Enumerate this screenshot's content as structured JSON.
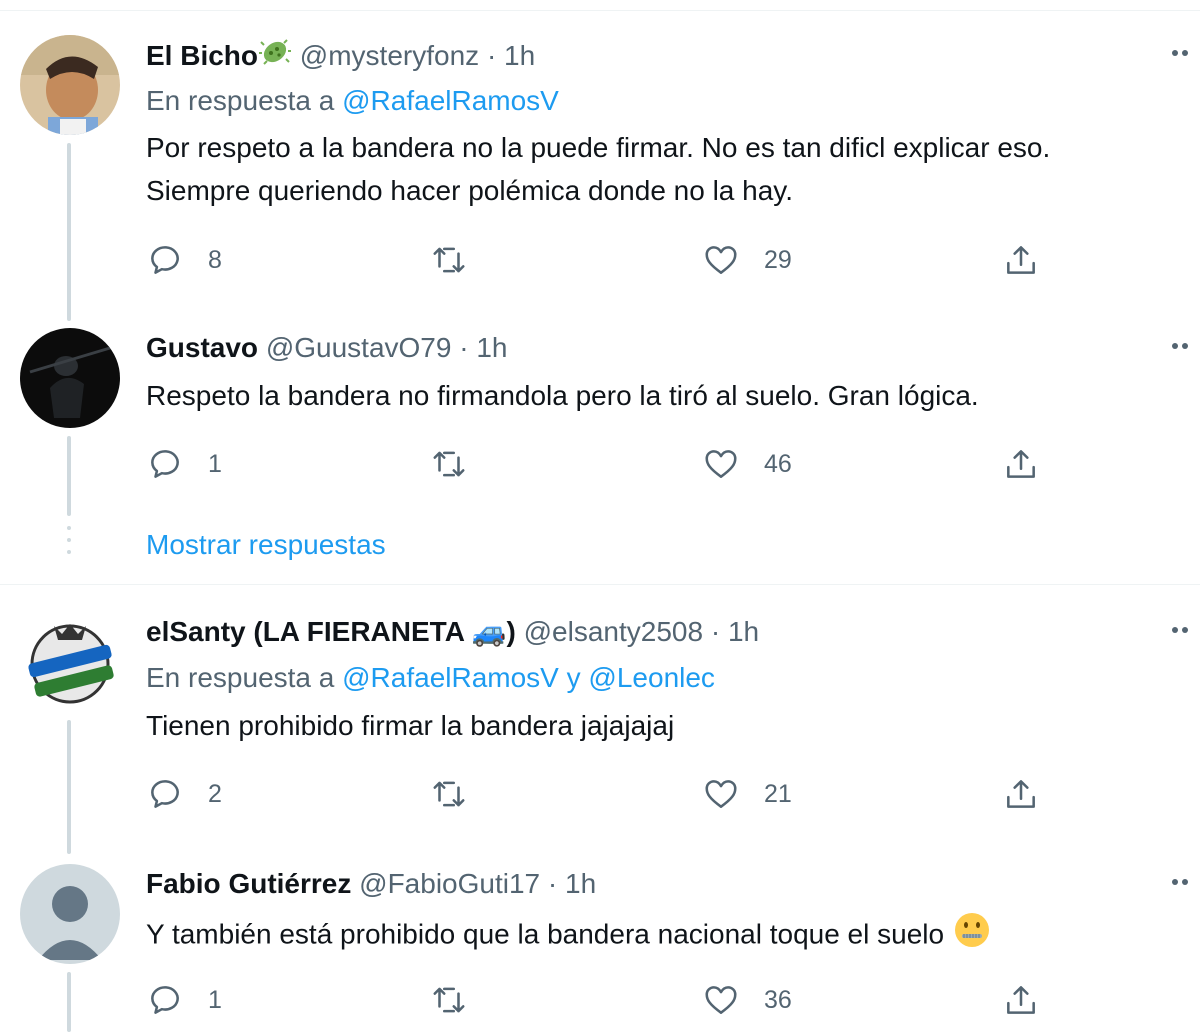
{
  "tweets": [
    {
      "name": "El Bicho",
      "handle": "@mysteryfonz",
      "sep": "·",
      "time": "1h",
      "reply_prefix": "En respuesta a",
      "reply_to": "@RafaelRamosV",
      "text_lines": [
        "Por respeto a la bandera no la puede firmar. No es tan dificl explicar eso.",
        "Siempre queriendo hacer polémica donde no la hay."
      ],
      "replies": "8",
      "retweets": "",
      "likes": "29"
    },
    {
      "name": "Gustavo",
      "handle": "@GuustavO79",
      "sep": "·",
      "time": "1h",
      "text_lines": [
        "Respeto la bandera no firmandola pero la tiró al suelo. Gran lógica."
      ],
      "replies": "1",
      "retweets": "",
      "likes": "46"
    },
    {
      "name": "elSanty (LA FIERANETA 🚙)",
      "handle": "@elsanty2508",
      "sep": "·",
      "time": "1h",
      "reply_prefix": "En respuesta a",
      "reply_to": "@RafaelRamosV y @Leonlec",
      "reply_to_1": "@RafaelRamosV",
      "reply_conj": "y",
      "reply_to_2": "@Leonlec",
      "text_lines": [
        "Tienen prohibido firmar la bandera jajajajaj"
      ],
      "replies": "2",
      "retweets": "",
      "likes": "21"
    },
    {
      "name": "Fabio Gutiérrez",
      "handle": "@FabioGuti17",
      "sep": "·",
      "time": "1h",
      "text_lines": [
        "Y también está prohibido que la bandera nacional toque el suelo"
      ],
      "replies": "1",
      "retweets": "",
      "likes": "36"
    }
  ],
  "show_replies_label": "Mostrar respuestas",
  "colors": {
    "link": "#1d9bf0",
    "secondary": "#536471",
    "thread_line": "#cfd9de",
    "divider": "#eff3f4"
  },
  "icons": [
    "reply-icon",
    "retweet-icon",
    "like-icon",
    "share-icon",
    "more-options-icon",
    "microbe-emoji",
    "car-emoji",
    "zipper-mouth-emoji"
  ]
}
